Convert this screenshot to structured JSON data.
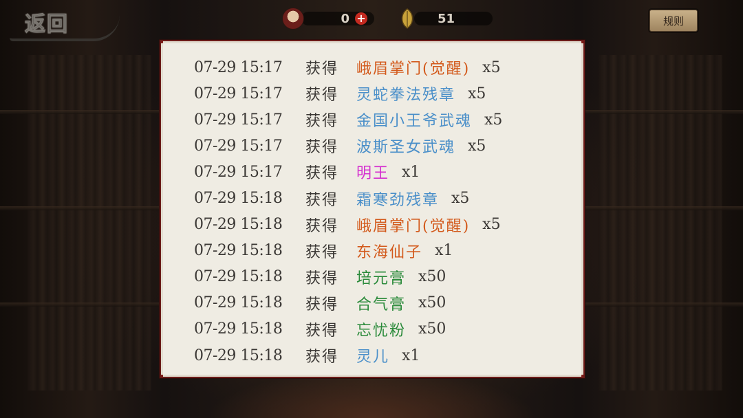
{
  "header": {
    "back_label": "返回",
    "resource_a_value": "0",
    "resource_b_value": "51",
    "rules_label": "规则"
  },
  "colors": {
    "orange": "#d35a1c",
    "blue": "#4a8fc9",
    "magenta": "#d42fcf",
    "green": "#2a8a3a"
  },
  "log": {
    "rows": [
      {
        "time": "07-29 15:17",
        "action": "获得",
        "item": "峨眉掌门(觉醒)",
        "qty": "x5",
        "color": "#d35a1c"
      },
      {
        "time": "07-29 15:17",
        "action": "获得",
        "item": "灵蛇拳法残章",
        "qty": "x5",
        "color": "#4a8fc9"
      },
      {
        "time": "07-29 15:17",
        "action": "获得",
        "item": "金国小王爷武魂",
        "qty": "x5",
        "color": "#4a8fc9"
      },
      {
        "time": "07-29 15:17",
        "action": "获得",
        "item": "波斯圣女武魂",
        "qty": "x5",
        "color": "#4a8fc9"
      },
      {
        "time": "07-29 15:17",
        "action": "获得",
        "item": "明王",
        "qty": "x1",
        "color": "#d42fcf"
      },
      {
        "time": "07-29 15:18",
        "action": "获得",
        "item": "霜寒劲残章",
        "qty": "x5",
        "color": "#4a8fc9"
      },
      {
        "time": "07-29 15:18",
        "action": "获得",
        "item": "峨眉掌门(觉醒)",
        "qty": "x5",
        "color": "#d35a1c"
      },
      {
        "time": "07-29 15:18",
        "action": "获得",
        "item": "东海仙子",
        "qty": "x1",
        "color": "#d35a1c"
      },
      {
        "time": "07-29 15:18",
        "action": "获得",
        "item": "培元膏",
        "qty": "x50",
        "color": "#2a8a3a"
      },
      {
        "time": "07-29 15:18",
        "action": "获得",
        "item": "合气膏",
        "qty": "x50",
        "color": "#2a8a3a"
      },
      {
        "time": "07-29 15:18",
        "action": "获得",
        "item": "忘忧粉",
        "qty": "x50",
        "color": "#2a8a3a"
      },
      {
        "time": "07-29 15:18",
        "action": "获得",
        "item": "灵儿",
        "qty": "x1",
        "color": "#4a8fc9"
      }
    ]
  }
}
